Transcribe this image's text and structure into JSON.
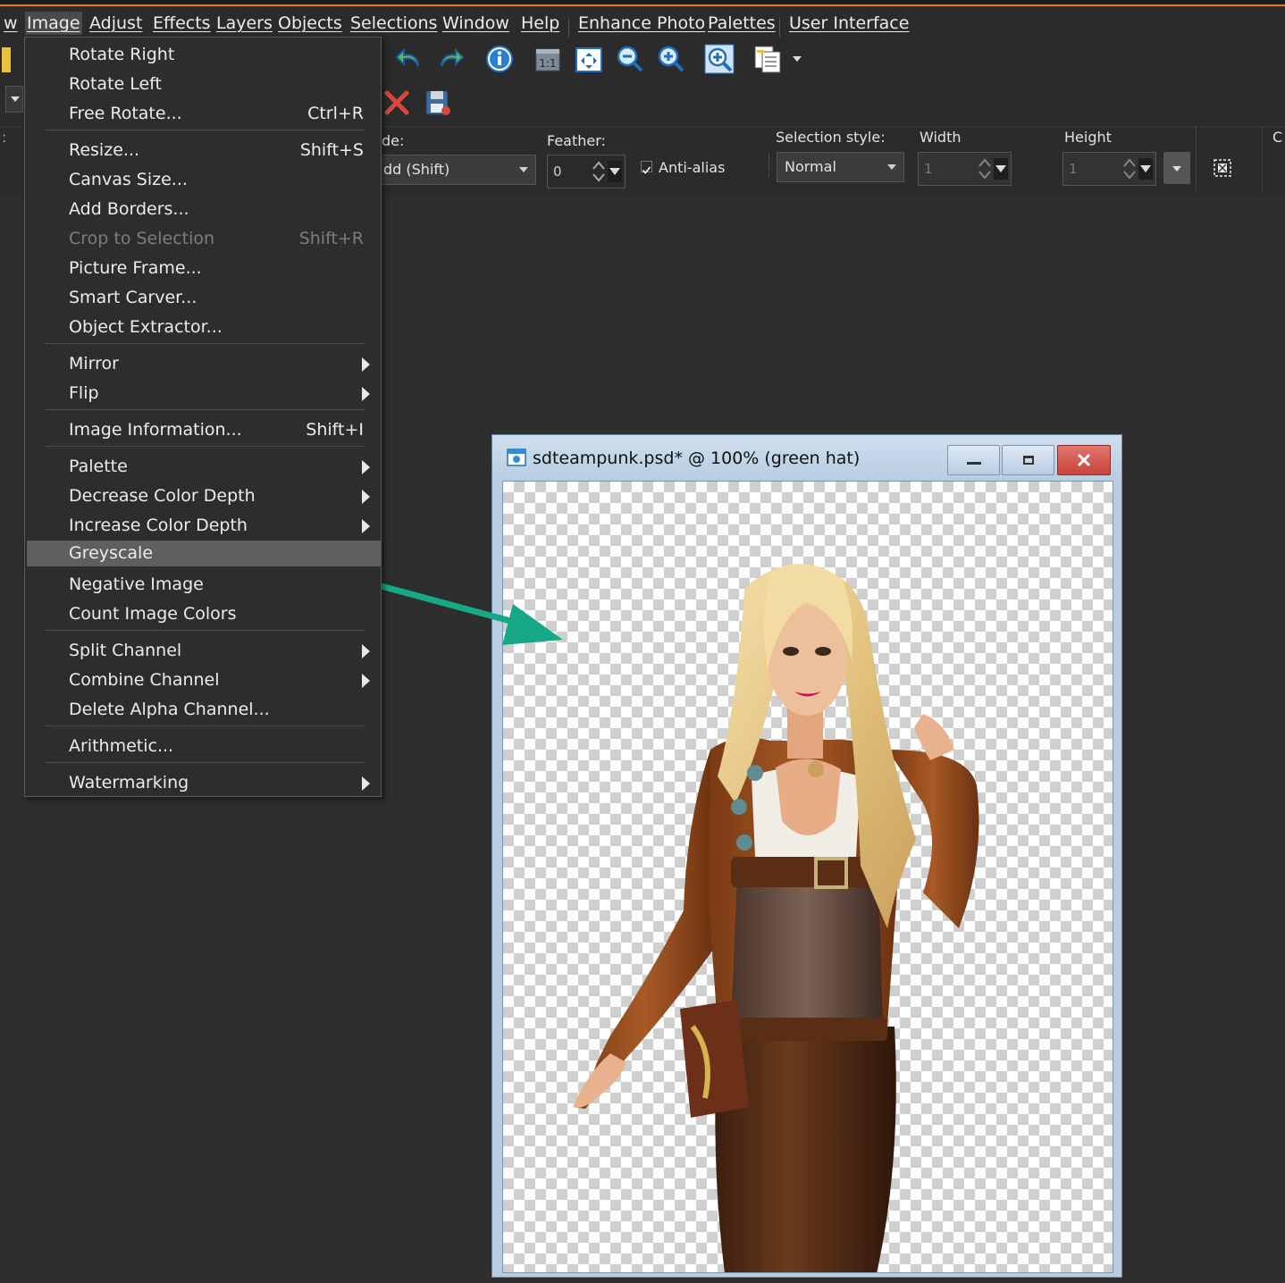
{
  "menubar": {
    "items": [
      {
        "label": "w"
      },
      {
        "label": "Image"
      },
      {
        "label": "Adjust"
      },
      {
        "label": "Effects"
      },
      {
        "label": "Layers"
      },
      {
        "label": "Objects"
      },
      {
        "label": "Selections"
      },
      {
        "label": "Window"
      },
      {
        "label": "Help"
      },
      {
        "label": "Enhance Photo"
      },
      {
        "label": "Palettes"
      },
      {
        "label": "User Interface"
      }
    ]
  },
  "image_menu": {
    "items": [
      {
        "label": "Rotate Right",
        "shortcut": ""
      },
      {
        "label": "Rotate Left",
        "shortcut": ""
      },
      {
        "label": "Free Rotate...",
        "shortcut": "Ctrl+R"
      },
      {
        "label": "Resize...",
        "shortcut": "Shift+S"
      },
      {
        "label": "Canvas Size...",
        "shortcut": ""
      },
      {
        "label": "Add Borders...",
        "shortcut": ""
      },
      {
        "label": "Crop to Selection",
        "shortcut": "Shift+R",
        "state": "disabled"
      },
      {
        "label": "Picture Frame...",
        "shortcut": ""
      },
      {
        "label": "Smart Carver...",
        "shortcut": ""
      },
      {
        "label": "Object Extractor...",
        "shortcut": ""
      },
      {
        "label": "Mirror",
        "shortcut": "",
        "submenu": true
      },
      {
        "label": "Flip",
        "shortcut": "",
        "submenu": true
      },
      {
        "label": "Image Information...",
        "shortcut": "Shift+I"
      },
      {
        "label": "Palette",
        "shortcut": "",
        "submenu": true
      },
      {
        "label": "Decrease Color Depth",
        "shortcut": "",
        "submenu": true
      },
      {
        "label": "Increase Color Depth",
        "shortcut": "",
        "submenu": true
      },
      {
        "label": "Greyscale",
        "shortcut": "",
        "state": "highlighted"
      },
      {
        "label": "Negative Image",
        "shortcut": ""
      },
      {
        "label": "Count Image Colors",
        "shortcut": ""
      },
      {
        "label": "Split Channel",
        "shortcut": "",
        "submenu": true
      },
      {
        "label": "Combine Channel",
        "shortcut": "",
        "submenu": true
      },
      {
        "label": "Delete Alpha Channel...",
        "shortcut": ""
      },
      {
        "label": "Arithmetic...",
        "shortcut": ""
      },
      {
        "label": "Watermarking",
        "shortcut": "",
        "submenu": true
      }
    ]
  },
  "toolbar": {
    "icons": [
      "undo-icon",
      "redo-icon",
      "info-icon",
      "actual-size-icon",
      "fit-window-icon",
      "zoom-out-icon",
      "zoom-in-icon",
      "zoom-tool-icon",
      "new-document-icon"
    ]
  },
  "options": {
    "mode_label": "de:",
    "mode_value": "dd (Shift)",
    "feather_label": "Feather:",
    "feather_value": "0",
    "antialias_label": "Anti-alias",
    "antialias_checked": true,
    "style_label": "Selection style:",
    "style_value": "Normal",
    "width_label": "Width",
    "width_value": "1",
    "height_label": "Height",
    "height_value": "1",
    "cutoff_label": "C"
  },
  "image_window": {
    "title": "sdteampunk.psd* @ 100% (green hat)"
  },
  "colors": {
    "accent": "#e07a2a",
    "arrow": "#17a887",
    "close": "#c9433b"
  }
}
